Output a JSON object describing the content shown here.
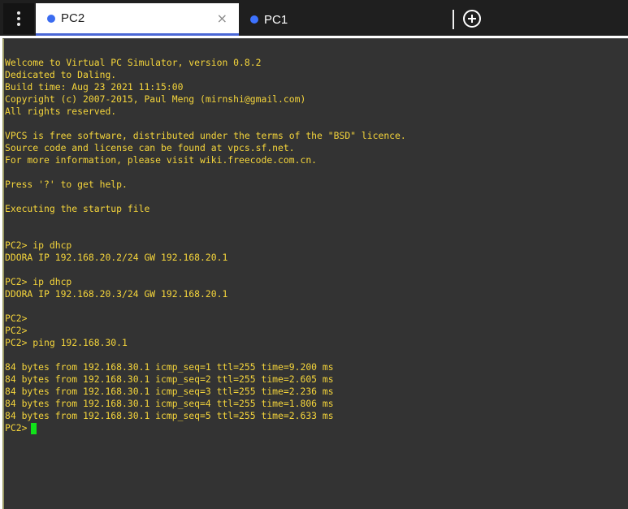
{
  "tabs": [
    {
      "label": "PC2",
      "active": true,
      "close_symbol": "×"
    },
    {
      "label": "PC1",
      "active": false
    }
  ],
  "colors": {
    "terminal_bg": "#333333",
    "terminal_text": "#f5d53b",
    "cursor": "#11e21a",
    "tab_dot": "#3b6cf0",
    "active_tab_underline": "#4a67d6",
    "tabbar_bg": "#1f1f1f"
  },
  "icons": {
    "menu": "vertical-dots-icon",
    "add_tab": "plus-circle-icon",
    "close": "close-icon"
  },
  "terminal": {
    "output": "Welcome to Virtual PC Simulator, version 0.8.2\nDedicated to Daling.\nBuild time: Aug 23 2021 11:15:00\nCopyright (c) 2007-2015, Paul Meng (mirnshi@gmail.com)\nAll rights reserved.\n\nVPCS is free software, distributed under the terms of the \"BSD\" licence.\nSource code and license can be found at vpcs.sf.net.\nFor more information, please visit wiki.freecode.com.cn.\n\nPress '?' to get help.\n\nExecuting the startup file\n\n\nPC2> ip dhcp\nDDORA IP 192.168.20.2/24 GW 192.168.20.1\n\nPC2> ip dhcp\nDDORA IP 192.168.20.3/24 GW 192.168.20.1\n\nPC2>\nPC2>\nPC2> ping 192.168.30.1\n\n84 bytes from 192.168.30.1 icmp_seq=1 ttl=255 time=9.200 ms\n84 bytes from 192.168.30.1 icmp_seq=2 ttl=255 time=2.605 ms\n84 bytes from 192.168.30.1 icmp_seq=3 ttl=255 time=2.236 ms\n84 bytes from 192.168.30.1 icmp_seq=4 ttl=255 time=1.806 ms\n84 bytes from 192.168.30.1 icmp_seq=5 ttl=255 time=2.633 ms\n",
    "prompt": "PC2>"
  }
}
